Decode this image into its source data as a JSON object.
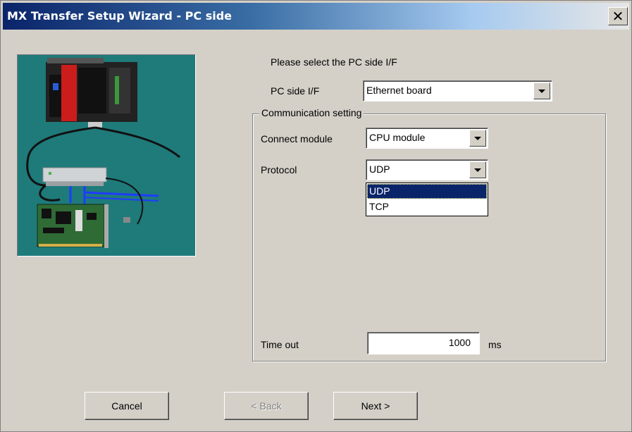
{
  "window": {
    "title": "MX Transfer Setup Wizard - PC side",
    "close_symbol": "✕"
  },
  "prompt": "Please select the PC side I/F",
  "pc_side_if": {
    "label": "PC side I/F",
    "value": "Ethernet board"
  },
  "communication": {
    "group_title": "Communication setting",
    "connect_module": {
      "label": "Connect module",
      "value": "CPU module"
    },
    "protocol": {
      "label": "Protocol",
      "value": "UDP",
      "options": [
        "UDP",
        "TCP"
      ],
      "selected_index": 0
    },
    "timeout": {
      "label": "Time out",
      "value": "1000",
      "unit": "ms"
    }
  },
  "buttons": {
    "cancel": "Cancel",
    "back": "< Back",
    "next": "Next >"
  },
  "illustration": {
    "icon": "plc-network-illustration",
    "background": "#1f7a7a"
  }
}
